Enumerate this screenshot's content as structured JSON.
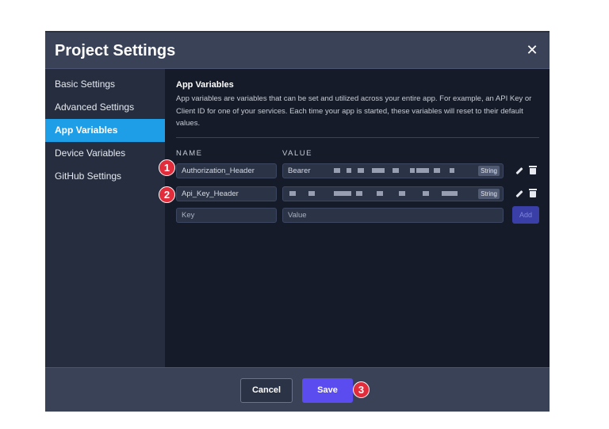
{
  "dialog": {
    "title": "Project Settings",
    "close_label": "✕"
  },
  "sidebar": {
    "items": [
      {
        "label": "Basic Settings",
        "active": false
      },
      {
        "label": "Advanced Settings",
        "active": false
      },
      {
        "label": "App Variables",
        "active": true
      },
      {
        "label": "Device Variables",
        "active": false
      },
      {
        "label": "GitHub Settings",
        "active": false
      }
    ]
  },
  "section": {
    "title": "App Variables",
    "description": "App variables are variables that can be set and utilized across your entire app. For example, an API Key or Client ID for one of your services. Each time your app is started, these variables will reset to their default values."
  },
  "table": {
    "name_header": "NAME",
    "value_header": "VALUE",
    "rows": [
      {
        "name": "Authorization_Header",
        "value": "Bearer",
        "type": "String"
      },
      {
        "name": "Api_Key_Header",
        "value": "",
        "type": "String"
      }
    ],
    "new_row": {
      "key_placeholder": "Key",
      "value_placeholder": "Value",
      "add_label": "Add"
    }
  },
  "footer": {
    "cancel_label": "Cancel",
    "save_label": "Save"
  },
  "annotations": [
    "1",
    "2",
    "3"
  ],
  "colors": {
    "accent_active": "#1f9ee8",
    "save_button": "#5b4cf0",
    "badge": "#e12d3b"
  }
}
